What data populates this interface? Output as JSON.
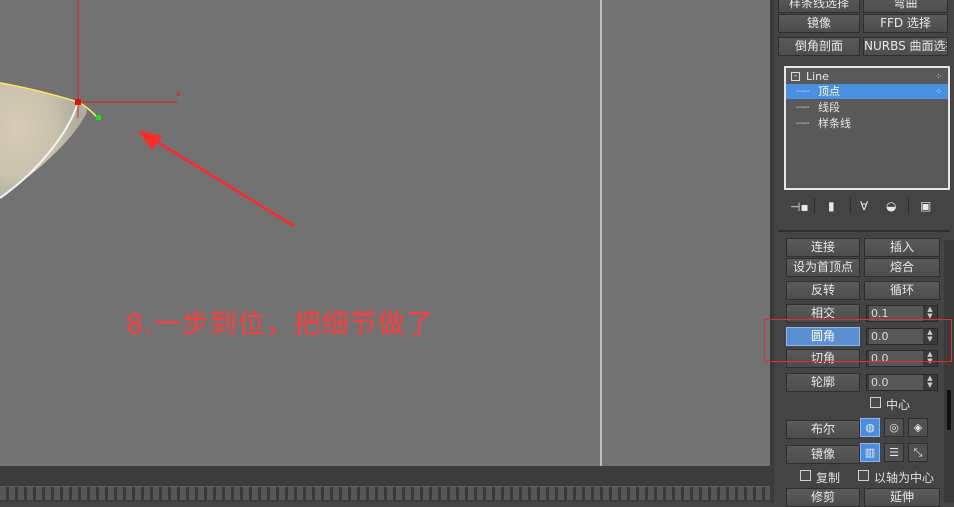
{
  "viewport": {
    "annotation_text": "8.一步到位，把细节做了",
    "axis_label": "x"
  },
  "panel": {
    "top_buttons": [
      {
        "label": "样条线选择"
      },
      {
        "label": "弯曲"
      },
      {
        "label": "镜像"
      },
      {
        "label": "FFD 选择"
      },
      {
        "label": "倒角剖面"
      },
      {
        "label": "NURBS 曲面选择"
      }
    ],
    "stack": {
      "root": "Line",
      "items": [
        "顶点",
        "线段",
        "样条线"
      ],
      "selected_item": "顶点"
    },
    "geometry": {
      "connect_label": "连接",
      "insert_label": "插入",
      "make_first_label": "设为首顶点",
      "fuse_label": "熔合",
      "reverse_label": "反转",
      "cycle_label": "循环",
      "cross_insert_label": "相交",
      "cross_insert_value": "0.1",
      "fillet_label": "圆角",
      "fillet_value": "0.0",
      "chamfer_label": "切角",
      "chamfer_value": "0.0",
      "outline_label": "轮廓",
      "outline_value": "0.0",
      "center_label": "中心",
      "boolean_label": "布尔",
      "mirror_label": "镜像",
      "copy_label": "复制",
      "about_pivot_label": "以轴为中心",
      "trim_label": "修剪",
      "extend_label": "延伸"
    }
  },
  "colors": {
    "viewport_bg": "#727272",
    "annotation": "#ff3b3b",
    "selection_blue": "#4a90e2",
    "highlight_box": "#e03030"
  }
}
